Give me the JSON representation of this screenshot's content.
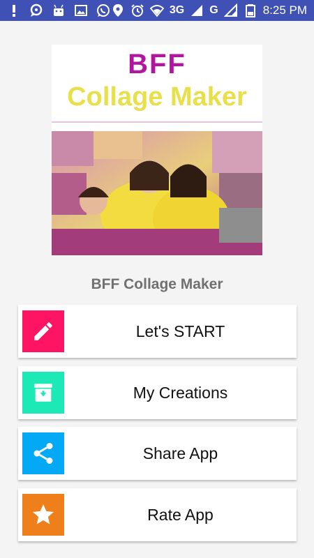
{
  "status_bar": {
    "icons_left": [
      "alert-icon",
      "chat-icon",
      "android-icon",
      "image-icon",
      "whatsapp-icon"
    ],
    "icons_right": [
      "location-icon",
      "alarm-icon",
      "wifi-icon"
    ],
    "network1": "3G",
    "network2": "G",
    "time": "8:25 PM"
  },
  "banner": {
    "title_line1": "BFF",
    "title_line2": "Collage Maker"
  },
  "app_name": "BFF Collage Maker",
  "menu": [
    {
      "label": "Let's START",
      "icon": "pencil-icon",
      "color": "#ff1464"
    },
    {
      "label": "My Creations",
      "icon": "download-box-icon",
      "color": "#1de9b6"
    },
    {
      "label": "Share App",
      "icon": "share-icon",
      "color": "#03a9f4"
    },
    {
      "label": "Rate App",
      "icon": "star-icon",
      "color": "#ef7f1a"
    }
  ],
  "colors": {
    "status_bar": "#3f51b5",
    "background": "#f4f4f4",
    "banner_title1": "#b0179e",
    "banner_title2": "#e8e04a"
  }
}
